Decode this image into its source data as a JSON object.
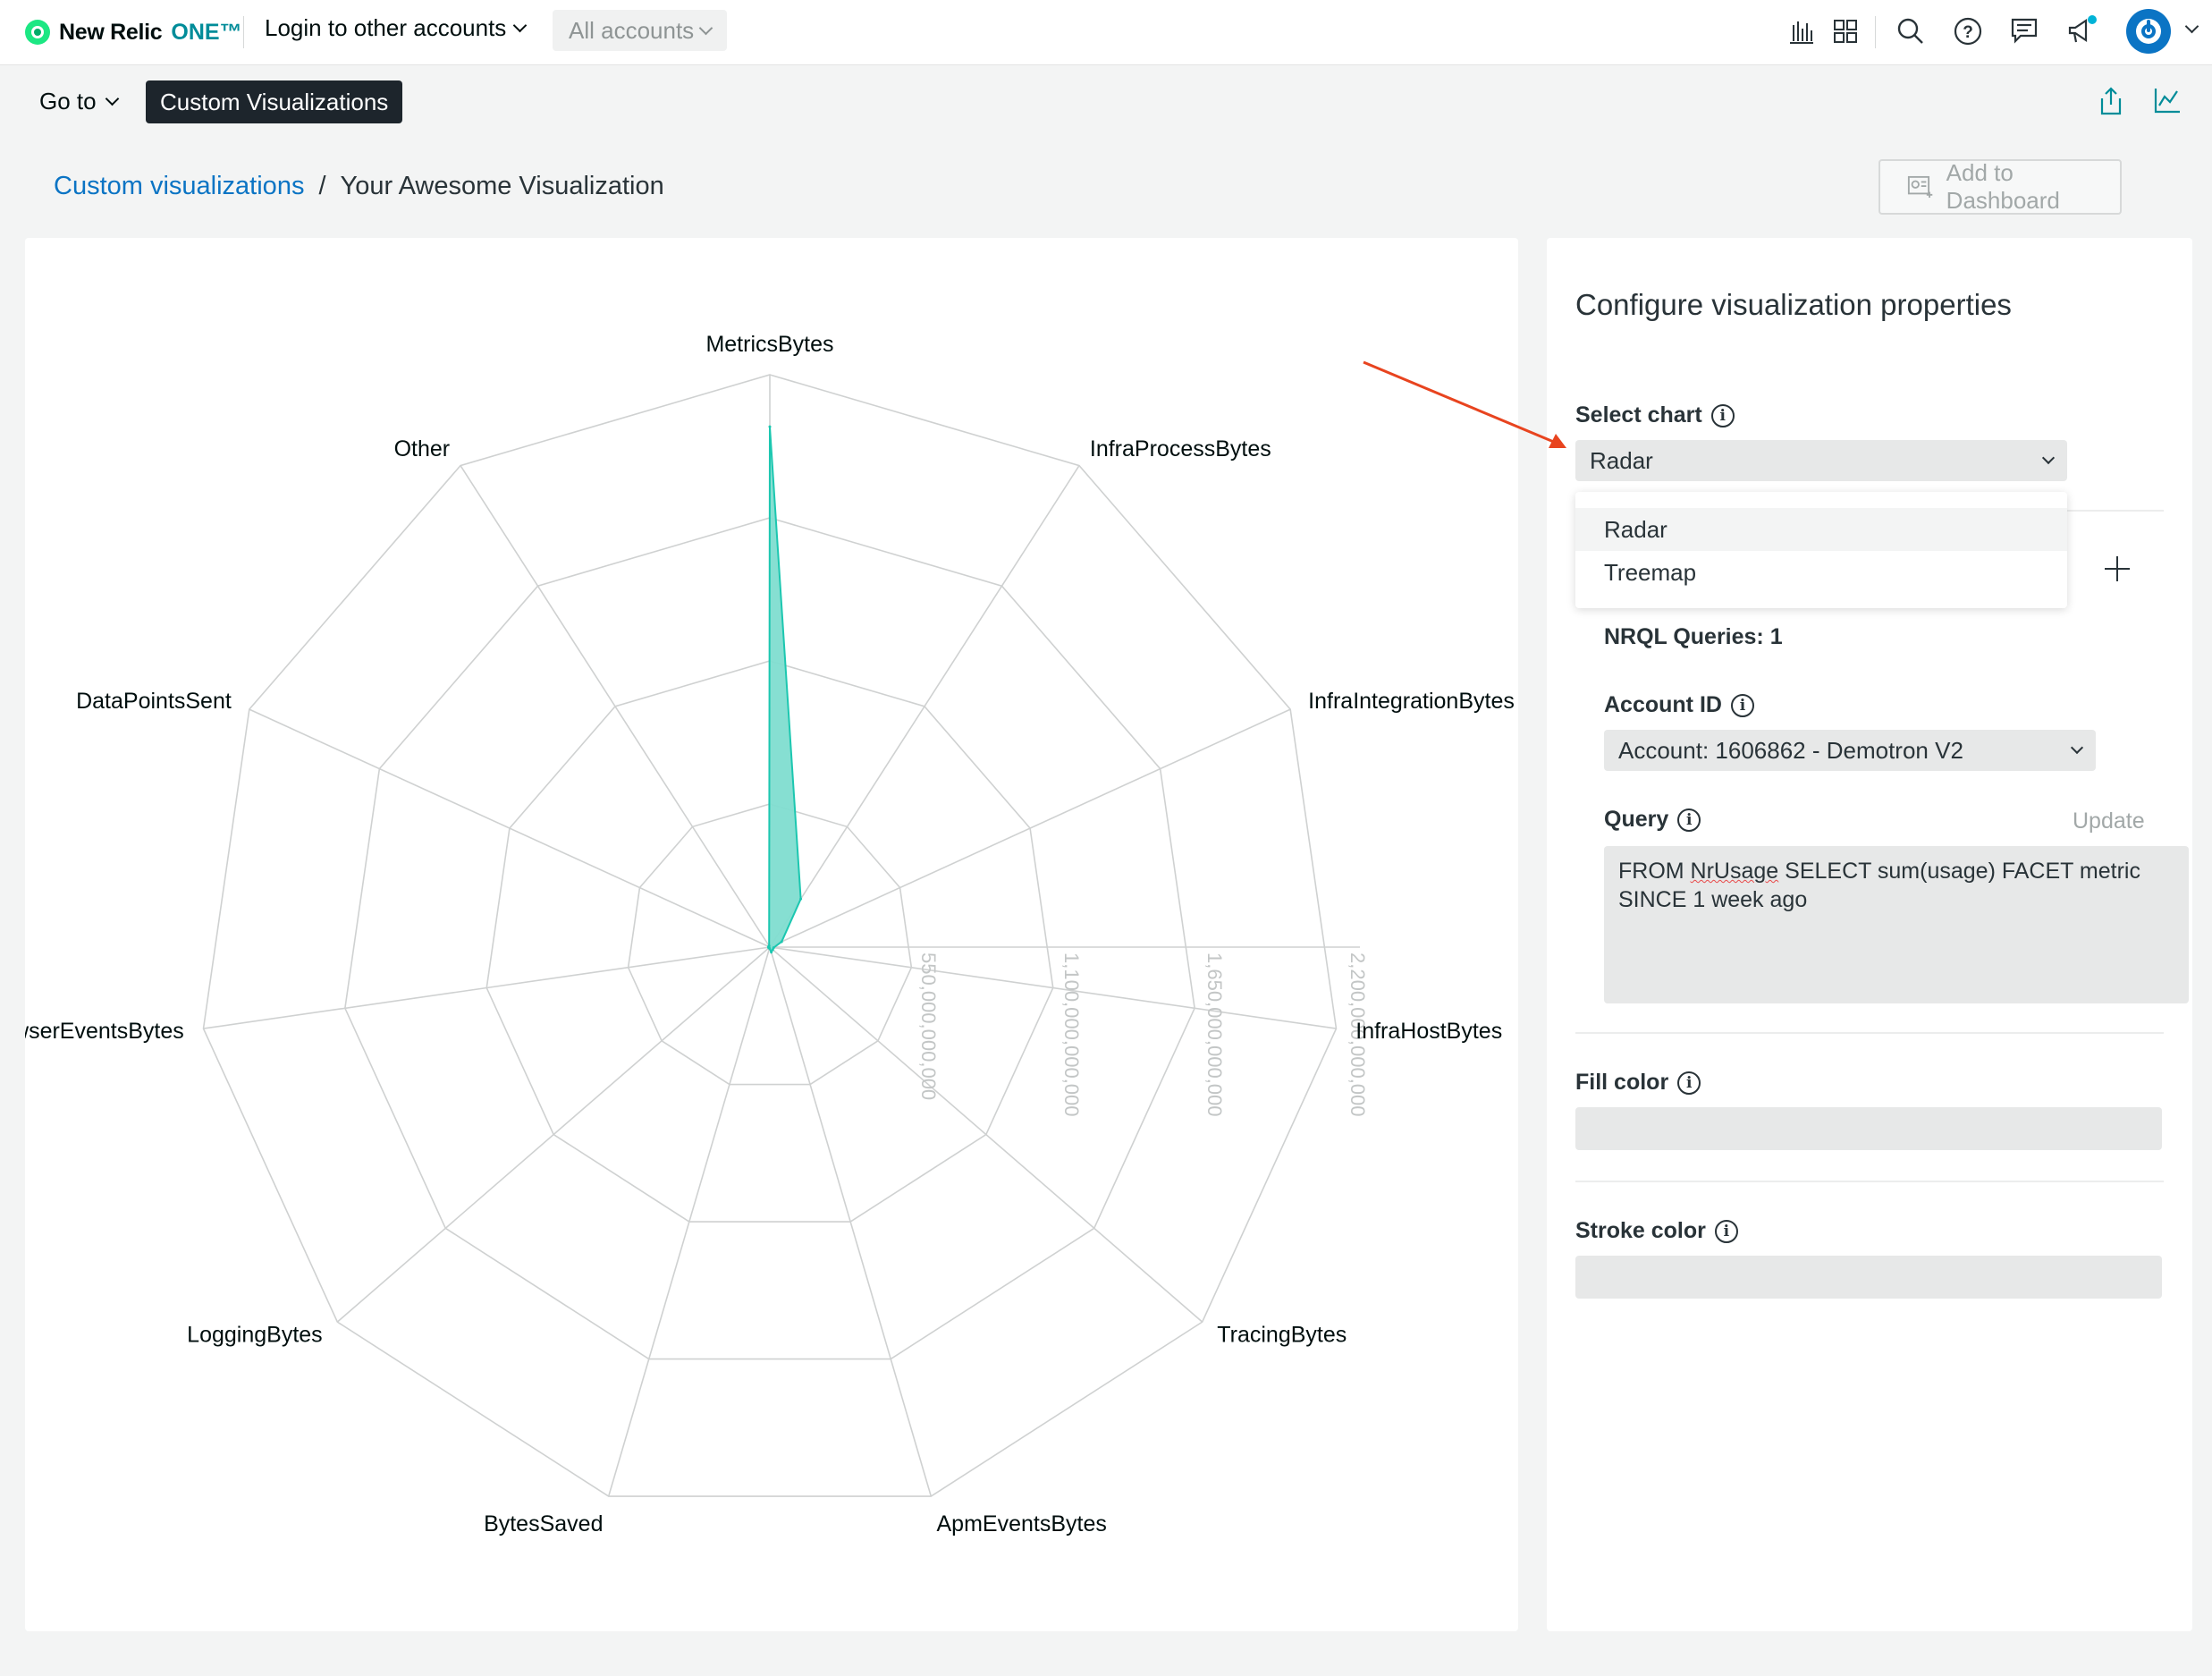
{
  "topbar": {
    "logo_text": "New Relic",
    "logo_one": "ONE™",
    "accounts_menu": "Login to other accounts",
    "all_accounts": "All accounts",
    "icons": [
      "chart-builder-icon",
      "apps-grid-icon",
      "search-icon",
      "help-icon",
      "feedback-icon",
      "announcements-icon",
      "user-avatar-icon"
    ],
    "notification_color": "#00b3d7"
  },
  "nav": {
    "goto_label": "Go to",
    "active_chip": "Custom Visualizations",
    "icons": [
      "share-icon",
      "chart-icon"
    ]
  },
  "breadcrumb": {
    "parent": "Custom visualizations",
    "separator": "/",
    "current": "Your Awesome Visualization"
  },
  "add_to_dashboard": "Add to Dashboard",
  "config": {
    "title": "Configure visualization properties",
    "select_chart_label": "Select chart",
    "select_chart_value": "Radar",
    "chart_options": [
      "Radar",
      "Treemap"
    ],
    "nrql_queries_label": "NRQL Queries: 1",
    "account_id_label": "Account ID",
    "account_value": "Account: 1606862 - Demotron V2",
    "query_label": "Query",
    "update_label": "Update",
    "query_text_prefix": "FROM ",
    "query_text_squig": "NrUsage",
    "query_text_suffix": " SELECT sum(usage) FACET metric SINCE 1 week ago",
    "fill_color_label": "Fill color",
    "stroke_color_label": "Stroke color"
  },
  "chart_data": {
    "type": "radar",
    "categories": [
      "MetricsBytes",
      "InfraProcessBytes",
      "InfraIntegrationBytes",
      "InfraHostBytes",
      "TracingBytes",
      "ApmEventsBytes",
      "BytesSaved",
      "LoggingBytes",
      "rowserEventsBytes",
      "DataPointsSent",
      "Other"
    ],
    "values": [
      2000000000000,
      220000000000,
      50000000000,
      15000000000,
      15000000000,
      20000000000,
      5000000000,
      5000000000,
      5000000000,
      5000000000,
      5000000000
    ],
    "radial_ticks": [
      "550,000,000,000",
      "1,100,000,000,000",
      "1,650,000,000,000",
      "2,200,000,000,000"
    ],
    "rmax": 2200000000000,
    "fill_color": "#7fddd0",
    "stroke_color": "#1cc7b0",
    "grid": true
  }
}
